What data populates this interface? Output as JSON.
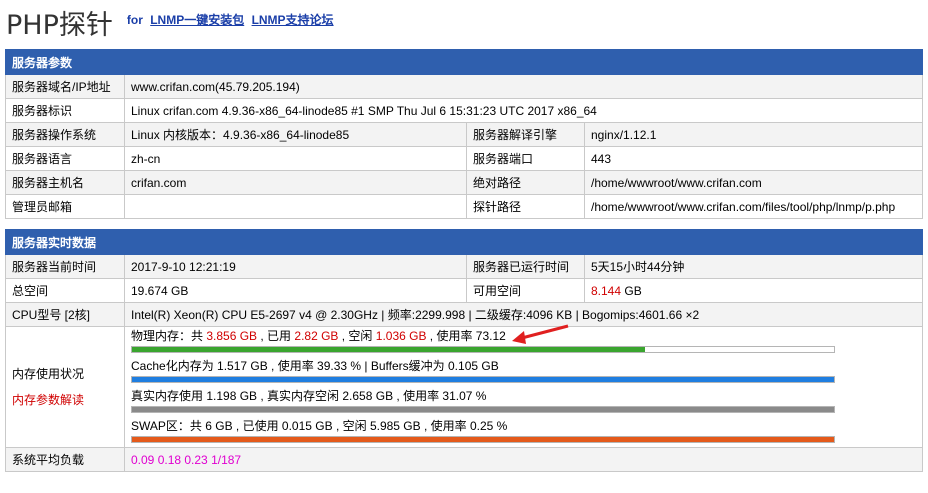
{
  "header": {
    "title": "PHP探针",
    "for_label": "for",
    "link1": "LNMP一键安装包",
    "link2": "LNMP支持论坛"
  },
  "server_params": {
    "section_title": "服务器参数",
    "rows": {
      "domain_label": "服务器域名/IP地址",
      "domain_value": "www.crifan.com(45.79.205.194)",
      "ident_label": "服务器标识",
      "ident_value": "Linux crifan.com 4.9.36-x86_64-linode85 #1 SMP Thu Jul 6 15:31:23 UTC 2017 x86_64",
      "os_label": "服务器操作系统",
      "os_value": "Linux  内核版本：4.9.36-x86_64-linode85",
      "engine_label": "服务器解译引擎",
      "engine_value": "nginx/1.12.1",
      "lang_label": "服务器语言",
      "lang_value": "zh-cn",
      "port_label": "服务器端口",
      "port_value": "443",
      "host_label": "服务器主机名",
      "host_value": "crifan.com",
      "abspath_label": "绝对路径",
      "abspath_value": "/home/wwwroot/www.crifan.com",
      "admin_label": "管理员邮箱",
      "admin_value": "",
      "probepath_label": "探针路径",
      "probepath_value": "/home/wwwroot/www.crifan.com/files/tool/php/lnmp/p.php"
    }
  },
  "realtime": {
    "section_title": "服务器实时数据",
    "time_label": "服务器当前时间",
    "time_value": "2017-9-10 12:21:19",
    "uptime_label": "服务器已运行时间",
    "uptime_value": "5天15小时44分钟",
    "total_label": "总空间",
    "total_value": "19.674 GB",
    "free_label": "可用空间",
    "free_value": "8.144",
    "free_unit": " GB",
    "cpu_label": "CPU型号 [2核]",
    "cpu_value": "Intel(R) Xeon(R) CPU E5-2697 v4 @ 2.30GHz | 频率:2299.998 | 二级缓存:4096 KB | Bogomips:4601.66 ×2",
    "mem_label": "内存使用状况",
    "mem_explain_link": "内存参数解读",
    "mem": {
      "physical_prefix": "物理内存：共 ",
      "physical_total": "3.856 GB",
      "physical_used_prefix": " , 已用 ",
      "physical_used": "2.82 GB",
      "physical_free_prefix": " , 空闲 ",
      "physical_free": "1.036 GB",
      "physical_rate_text": " , 使用率 73.12",
      "physical_rate": 73.12,
      "cache_text": "Cache化内存为 1.517 GB , 使用率 39.33 % | Buffers缓冲为 0.105 GB",
      "cache_rate": 100,
      "real_text": "真实内存使用 1.198 GB , 真实内存空闲 2.658 GB , 使用率 31.07 %",
      "real_rate": 100,
      "swap_text": "SWAP区：共 6 GB , 已使用 0.015 GB , 空闲 5.985 GB , 使用率 0.25 %",
      "swap_rate": 100
    },
    "load_label": "系统平均负载",
    "load_value": "0.09 0.18 0.23 1/187"
  },
  "colors": {
    "section_bg": "#2f5fae",
    "physical_bar": "#3aa52f",
    "cache_bar": "#1f7ee0",
    "real_bar": "#8a8a8a",
    "swap_bar": "#e45a1b",
    "arrow": "#e02020"
  }
}
